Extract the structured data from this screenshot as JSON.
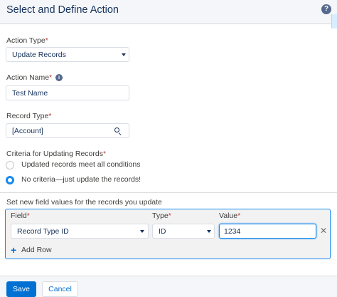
{
  "dialog": {
    "title": "Select and Define Action",
    "help_icon": "question-icon"
  },
  "action_type": {
    "label": "Action Type",
    "required": "*",
    "value": "Update Records"
  },
  "action_name": {
    "label": "Action Name",
    "required": "*",
    "info_icon": "info-icon",
    "value": "Test Name"
  },
  "record_type": {
    "label": "Record Type",
    "required": "*",
    "value": "[Account]",
    "icon": "search-icon"
  },
  "criteria": {
    "label": "Criteria for Updating Records",
    "required": "*",
    "options": [
      {
        "label": "Updated records meet all conditions",
        "checked": false
      },
      {
        "label": "No criteria—just update the records!",
        "checked": true
      }
    ]
  },
  "field_values": {
    "heading": "Set new field values for the records you update",
    "columns": {
      "field": "Field",
      "type": "Type",
      "value": "Value",
      "required": "*"
    },
    "rows": [
      {
        "field": "Record Type ID",
        "type": "ID",
        "value": "1234"
      }
    ],
    "add_row": "Add Row",
    "remove_icon": "close-icon",
    "add_icon": "plus-icon"
  },
  "footer": {
    "save": "Save",
    "cancel": "Cancel"
  },
  "colors": {
    "brand": "#0070d2",
    "focus": "#1589ee",
    "required": "#c23934",
    "text": "#16325c"
  }
}
